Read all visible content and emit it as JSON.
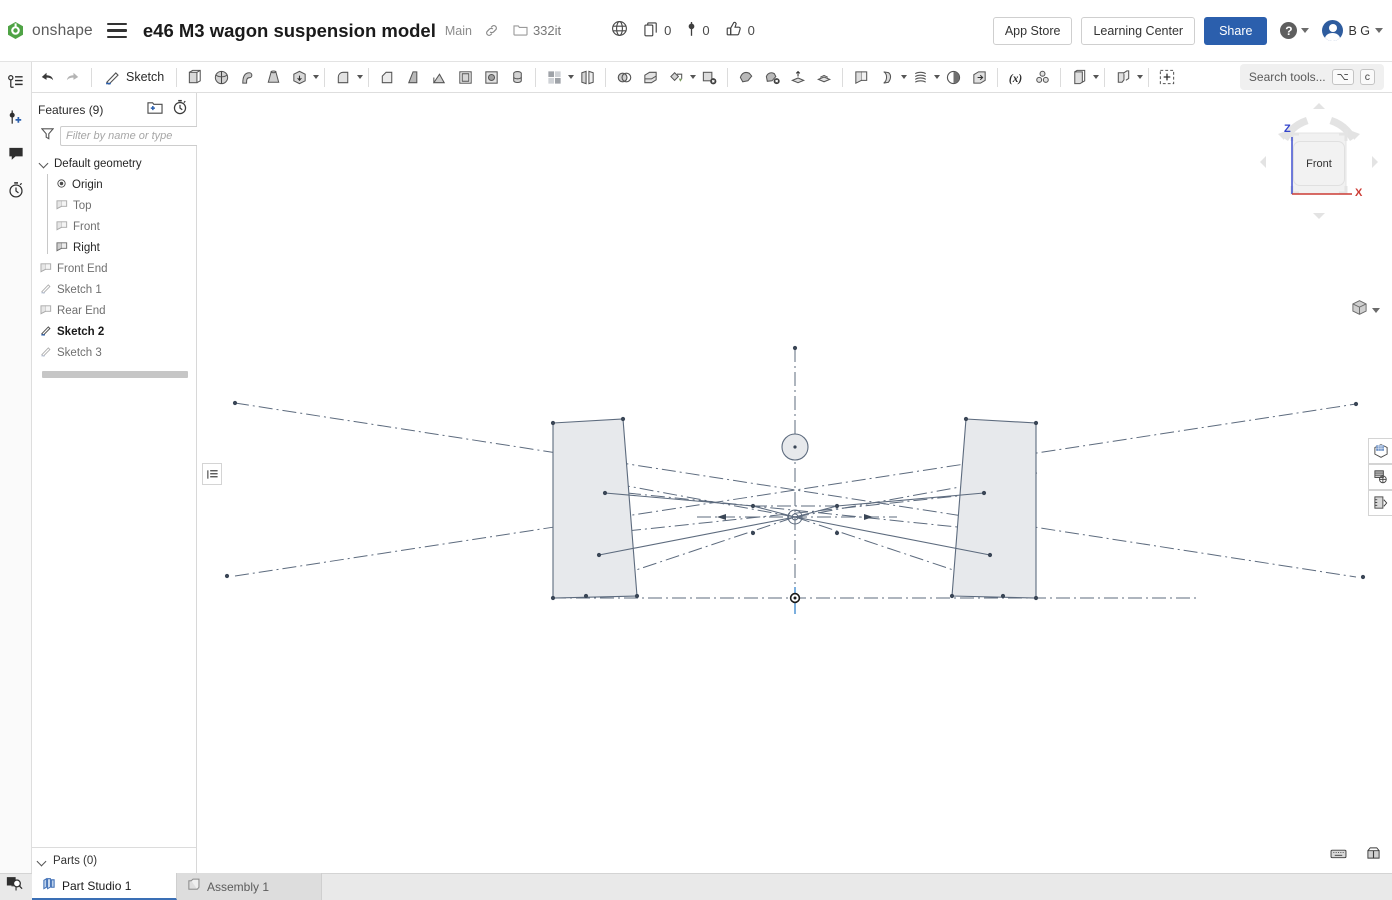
{
  "app": {
    "name": "onshape",
    "logo_color": "#4fa345"
  },
  "header": {
    "document_title": "e46 M3 wagon suspension model",
    "branch": "Main",
    "link_icon": "link-icon",
    "folder_icon": "folder-icon",
    "folder_name": "332it",
    "globe_icon": "globe-icon",
    "counts": [
      {
        "icon": "copy-icon",
        "name": "copies-count",
        "value": "0"
      },
      {
        "icon": "pin-icon",
        "name": "pins-count",
        "value": "0"
      },
      {
        "icon": "thumbs-up-icon",
        "name": "likes-count",
        "value": "0"
      }
    ],
    "app_store_label": "App Store",
    "learning_center_label": "Learning Center",
    "share_label": "Share",
    "share_color": "#2b5fad",
    "help_glyph": "?",
    "user_initials": "B G"
  },
  "toolbar": {
    "undo_icon": "undo-icon",
    "redo_icon": "redo-icon",
    "sketch_label": "Sketch",
    "search_placeholder": "Search tools...",
    "search_kbd_1": "⌥",
    "search_kbd_2": "c",
    "tools": [
      "extrude-icon",
      "revolve-icon",
      "sweep-icon",
      "loft-icon",
      "thicken-icon",
      "fillet-icon",
      "chamfer-icon",
      "draft-icon",
      "rib-icon",
      "shell-icon",
      "hole-icon",
      "pattern-icon",
      "mirror-icon",
      "boolean-icon",
      "split-icon",
      "transform-icon",
      "delete-face-icon",
      "move-face-icon",
      "replace-face-icon",
      "offset-surface-icon",
      "enclose-icon",
      "plane-icon",
      "curve-icon",
      "helix-icon",
      "sheet-metal-icon",
      "import-icon",
      "variable-icon",
      "composite-part-icon",
      "derived-icon",
      "assembly-feature-icon",
      "custom-feature-icon"
    ]
  },
  "rail": {
    "items": [
      {
        "name": "feature-list-icon",
        "label": "Feature list"
      },
      {
        "name": "add-version-icon",
        "label": "Versions and history"
      },
      {
        "name": "comments-icon",
        "label": "Comments"
      },
      {
        "name": "history-icon",
        "label": "History"
      }
    ],
    "bottom_icon": "element-search-icon"
  },
  "features_panel": {
    "title": "Features (9)",
    "new_folder_icon": "new-folder-icon",
    "timer_icon": "timer-icon",
    "filter_icon": "filter-icon",
    "filter_placeholder": "Filter by name or type",
    "tree": [
      {
        "label": "Default geometry",
        "icon": "chevron-down-icon",
        "style": "dark",
        "level": 0
      },
      {
        "label": "Origin",
        "icon": "origin-icon",
        "style": "dark",
        "level": 1
      },
      {
        "label": "Top",
        "icon": "plane-icon",
        "style": "muted",
        "level": 1
      },
      {
        "label": "Front",
        "icon": "plane-icon",
        "style": "muted",
        "level": 1
      },
      {
        "label": "Right",
        "icon": "plane-icon",
        "style": "dark",
        "level": 1
      },
      {
        "label": "Front End",
        "icon": "plane-icon",
        "style": "muted",
        "level": 0
      },
      {
        "label": "Sketch 1",
        "icon": "sketch-icon",
        "style": "muted",
        "level": 0
      },
      {
        "label": "Rear End",
        "icon": "plane-icon",
        "style": "muted",
        "level": 0
      },
      {
        "label": "Sketch 2",
        "icon": "sketch-icon",
        "style": "bold",
        "level": 0
      },
      {
        "label": "Sketch 3",
        "icon": "sketch-icon",
        "style": "muted",
        "level": 0
      }
    ],
    "parts_label": "Parts (0)"
  },
  "graphics": {
    "legend_toggle_icon": "display-list-icon",
    "view_cube": {
      "face_label": "Front",
      "axis_z_label": "Z",
      "axis_z_color": "#3344cc",
      "axis_x_label": "X",
      "axis_x_color": "#cc3b34",
      "display_mode_icon": "shaded-cube-icon"
    },
    "right_tools": [
      {
        "name": "appearance-icon"
      },
      {
        "name": "render-icon"
      },
      {
        "name": "measure-icon"
      }
    ],
    "corner_tools": [
      {
        "name": "keyboard-shortcuts-icon"
      },
      {
        "name": "measure-tool-icon"
      }
    ],
    "sketch_color": "#5d6b7e",
    "face_fill": "#e7e9ec",
    "selection_color": "#5b9bd5"
  },
  "tabs": {
    "add_label": "+",
    "items": [
      {
        "label": "Part Studio 1",
        "icon": "part-studio-icon",
        "active": true
      },
      {
        "label": "Assembly 1",
        "icon": "assembly-icon",
        "active": false
      }
    ]
  }
}
